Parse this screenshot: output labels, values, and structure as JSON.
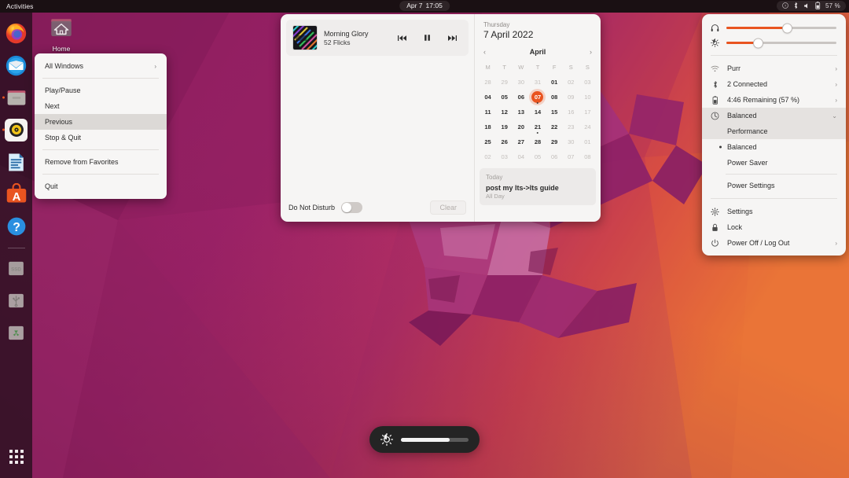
{
  "topbar": {
    "activities": "Activities",
    "clock_date": "Apr 7",
    "clock_time": "17:05",
    "battery_percent": "57 %",
    "icons": [
      "help-icon",
      "bluetooth-icon",
      "volume-icon",
      "battery-icon"
    ]
  },
  "desktop": {
    "home_icon_label": "Home"
  },
  "dock": {
    "items": [
      {
        "name": "firefox",
        "running": false
      },
      {
        "name": "thunderbird",
        "running": false
      },
      {
        "name": "files",
        "running": true
      },
      {
        "name": "rhythmbox",
        "running": true
      },
      {
        "name": "libreoffice-writer",
        "running": false
      },
      {
        "name": "ubuntu-software",
        "running": false
      },
      {
        "name": "help",
        "running": false
      },
      {
        "name": "ssd-drive",
        "label": "SSD",
        "running": false
      },
      {
        "name": "usb-drive",
        "running": false
      },
      {
        "name": "trash",
        "running": false
      }
    ]
  },
  "dock_menu": {
    "items": [
      {
        "label": "All Windows",
        "submenu": true,
        "selected": false
      },
      {
        "label": "Play/Pause",
        "submenu": false,
        "selected": false
      },
      {
        "label": "Next",
        "submenu": false,
        "selected": false
      },
      {
        "label": "Previous",
        "submenu": false,
        "selected": true
      },
      {
        "label": "Stop & Quit",
        "submenu": false,
        "selected": false
      },
      {
        "label": "Remove from Favorites",
        "submenu": false,
        "selected": false
      },
      {
        "label": "Quit",
        "submenu": false,
        "selected": false
      }
    ]
  },
  "media": {
    "title": "Morning Glory",
    "artist": "52 Flicks",
    "previous_icon": "skip-previous-icon",
    "playpause_icon": "pause-icon",
    "next_icon": "skip-next-icon"
  },
  "notifications": {
    "dnd_label": "Do Not Disturb",
    "dnd_on": false,
    "clear_label": "Clear"
  },
  "calendar": {
    "weekday": "Thursday",
    "date": "7 April 2022",
    "month": "April",
    "prev_arrow": "‹",
    "next_arrow": "›",
    "dow": [
      "M",
      "T",
      "W",
      "T",
      "F",
      "S",
      "S"
    ],
    "weeks": [
      [
        {
          "d": "28",
          "dim": true
        },
        {
          "d": "29",
          "dim": true
        },
        {
          "d": "30",
          "dim": true
        },
        {
          "d": "31",
          "dim": true
        },
        {
          "d": "01",
          "dim": false
        },
        {
          "d": "02",
          "dim": true
        },
        {
          "d": "03",
          "dim": true
        }
      ],
      [
        {
          "d": "04",
          "dim": false
        },
        {
          "d": "05",
          "dim": false
        },
        {
          "d": "06",
          "dim": false
        },
        {
          "d": "07",
          "dim": false,
          "today": true,
          "event": true
        },
        {
          "d": "08",
          "dim": false
        },
        {
          "d": "09",
          "dim": true
        },
        {
          "d": "10",
          "dim": true
        }
      ],
      [
        {
          "d": "11",
          "dim": false
        },
        {
          "d": "12",
          "dim": false
        },
        {
          "d": "13",
          "dim": false
        },
        {
          "d": "14",
          "dim": false
        },
        {
          "d": "15",
          "dim": false
        },
        {
          "d": "16",
          "dim": true
        },
        {
          "d": "17",
          "dim": true
        }
      ],
      [
        {
          "d": "18",
          "dim": false
        },
        {
          "d": "19",
          "dim": false
        },
        {
          "d": "20",
          "dim": false
        },
        {
          "d": "21",
          "dim": false,
          "event": true
        },
        {
          "d": "22",
          "dim": false
        },
        {
          "d": "23",
          "dim": true
        },
        {
          "d": "24",
          "dim": true
        }
      ],
      [
        {
          "d": "25",
          "dim": false
        },
        {
          "d": "26",
          "dim": false
        },
        {
          "d": "27",
          "dim": false
        },
        {
          "d": "28",
          "dim": false
        },
        {
          "d": "29",
          "dim": false
        },
        {
          "d": "30",
          "dim": true
        },
        {
          "d": "01",
          "dim": true
        }
      ],
      [
        {
          "d": "02",
          "dim": true
        },
        {
          "d": "03",
          "dim": true
        },
        {
          "d": "04",
          "dim": true
        },
        {
          "d": "05",
          "dim": true
        },
        {
          "d": "06",
          "dim": true
        },
        {
          "d": "07",
          "dim": true
        },
        {
          "d": "08",
          "dim": true
        }
      ]
    ],
    "events_header": "Today",
    "event_title": "post my lts->lts guide",
    "event_time": "All Day"
  },
  "system_menu": {
    "volume_icon": "headphones-icon",
    "volume_percent": 55,
    "brightness_icon": "brightness-icon",
    "brightness_percent": 29,
    "rows": [
      {
        "label": "Purr",
        "icon": "wifi-icon",
        "chevron": true
      },
      {
        "label": "2 Connected",
        "icon": "bluetooth-icon",
        "chevron": true
      },
      {
        "label": "4:46 Remaining (57 %)",
        "icon": "battery-icon",
        "chevron": true
      },
      {
        "label": "Balanced",
        "icon": "power-profile-icon",
        "expanded": true
      }
    ],
    "power_profiles": [
      {
        "label": "Performance",
        "selected": false,
        "hover": true
      },
      {
        "label": "Balanced",
        "selected": true,
        "hover": false
      },
      {
        "label": "Power Saver",
        "selected": false,
        "hover": false
      }
    ],
    "power_settings_label": "Power Settings",
    "bottom_rows": [
      {
        "label": "Settings",
        "icon": "gear-icon",
        "chevron": false
      },
      {
        "label": "Lock",
        "icon": "lock-icon",
        "chevron": false
      },
      {
        "label": "Power Off / Log Out",
        "icon": "power-icon",
        "chevron": true
      }
    ]
  },
  "osd": {
    "icon": "brightness-icon",
    "value_percent": 72
  },
  "colors": {
    "accent": "#e95420",
    "panel_bg": "#f6f5f4",
    "topbar_bg": "#1a1013",
    "wallpaper_magenta": "#a4236b",
    "wallpaper_orange": "#e8603c"
  }
}
